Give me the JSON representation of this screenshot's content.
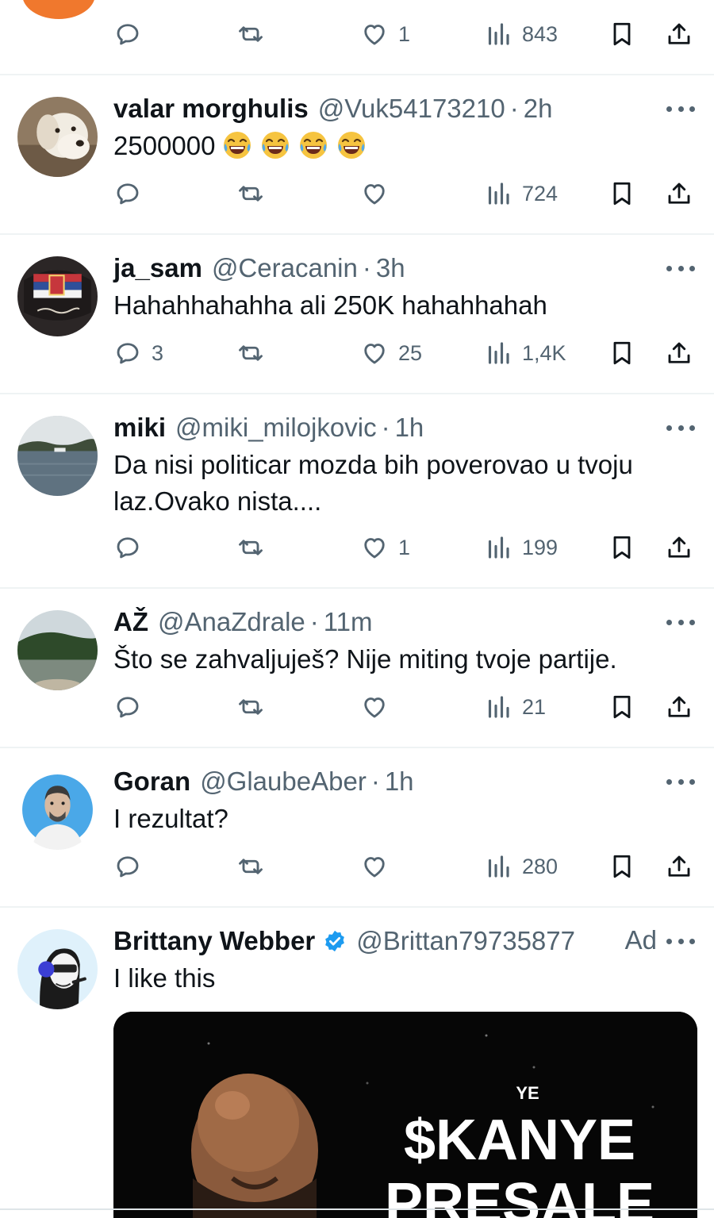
{
  "feed": {
    "top_partial": {
      "actions": {
        "replies": "",
        "retweets": "",
        "likes": "1",
        "views": "843"
      }
    },
    "tweets": [
      {
        "name": "valar morghulis",
        "handle": "@Vuk54173210",
        "separator": "·",
        "time": "2h",
        "text": "2500000",
        "emoji_count": 4,
        "avatar_icon": "dog-avatar",
        "actions": {
          "replies": "",
          "retweets": "",
          "likes": "",
          "views": "724"
        }
      },
      {
        "name": "ja_sam",
        "handle": "@Ceracanin",
        "separator": "·",
        "time": "3h",
        "text": "Hahahhahahha ali 250K hahahhahah",
        "avatar_icon": "flag-avatar",
        "actions": {
          "replies": "3",
          "retweets": "",
          "likes": "25",
          "views": "1,4K"
        }
      },
      {
        "name": "miki",
        "handle": "@miki_milojkovic",
        "separator": "·",
        "time": "1h",
        "text_line1": "Da nisi politicar mozda bih poverovao u tvoju",
        "text_line2": "laz.Ovako nista....",
        "avatar_icon": "lake-avatar",
        "actions": {
          "replies": "",
          "retweets": "",
          "likes": "1",
          "views": "199"
        }
      },
      {
        "name": "AŽ",
        "handle": "@AnaZdrale",
        "separator": "·",
        "time": "11m",
        "text": "Što se zahvaljuješ? Nije miting tvoje partije.",
        "avatar_icon": "landscape-avatar",
        "actions": {
          "replies": "",
          "retweets": "",
          "likes": "",
          "views": "21"
        }
      },
      {
        "name": "Goran",
        "handle": "@GlaubeAber",
        "separator": "·",
        "time": "1h",
        "text": "I rezultat?",
        "avatar_icon": "portrait-avatar",
        "actions": {
          "replies": "",
          "retweets": "",
          "likes": "",
          "views": "280"
        }
      },
      {
        "name": "Brittany Webber",
        "handle": "@Brittan79735877",
        "ad_label": "Ad",
        "text": "I like this",
        "avatar_icon": "cartoon-avatar",
        "verified": true,
        "ad_image": {
          "line_small": "YE",
          "line_big1": "$KANYE",
          "line_big2": "PRESALE"
        }
      }
    ]
  },
  "colors": {
    "text_primary": "#0f1419",
    "text_secondary": "#536471",
    "divider": "#eff3f4",
    "verified_blue": "#1d9bf0",
    "top_avatar": "#f0782d"
  },
  "icons": [
    "reply-icon",
    "retweet-icon",
    "like-icon",
    "views-icon",
    "bookmark-icon",
    "share-icon",
    "more-icon",
    "verified-badge-icon",
    "laughing-emoji-icon"
  ]
}
